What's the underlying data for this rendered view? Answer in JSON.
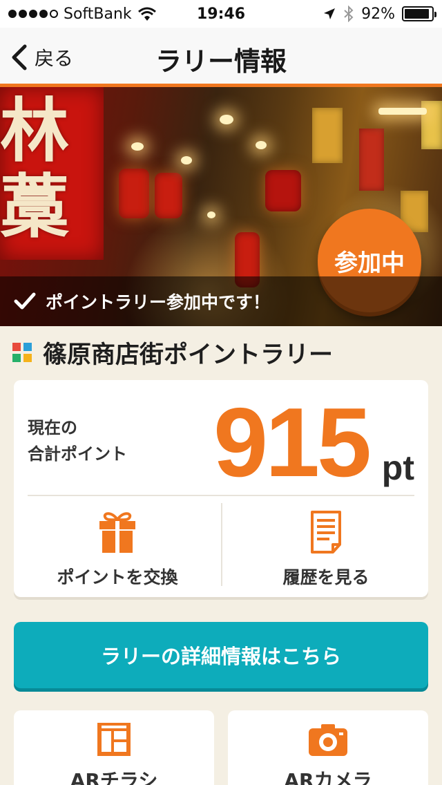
{
  "status_bar": {
    "carrier": "SoftBank",
    "time": "19:46",
    "battery_text": "92%",
    "battery_level": 0.92,
    "signal_bars_filled": 4,
    "signal_bars_total": 5
  },
  "nav": {
    "back_label": "戻る",
    "title": "ラリー情報"
  },
  "hero": {
    "badge": "参加中",
    "caption": "ポイントラリー参加中です！",
    "sign_glyphs": "林 藁"
  },
  "rally": {
    "name": "篠原商店街ポイントラリー",
    "tile_colors": [
      "#e84a3c",
      "#2b9fd8",
      "#26b06a",
      "#f5b21a"
    ]
  },
  "points": {
    "label_line1": "現在の",
    "label_line2": "合計ポイント",
    "value": "915",
    "unit": "pt"
  },
  "actions": {
    "exchange_label": "ポイントを交換",
    "history_label": "履歴を見る"
  },
  "detail_button": "ラリーの詳細情報はこちら",
  "tiles": {
    "flyer_label": "ARチラシ",
    "camera_label": "ARカメラ"
  },
  "colors": {
    "accent": "#f0771f",
    "teal": "#0dacbb",
    "background": "#f4efe3"
  },
  "icons": {
    "back": "chevron-left-icon",
    "check": "check-icon",
    "gift": "gift-icon",
    "history": "document-icon",
    "flyer": "flyer-icon",
    "camera": "camera-icon"
  }
}
